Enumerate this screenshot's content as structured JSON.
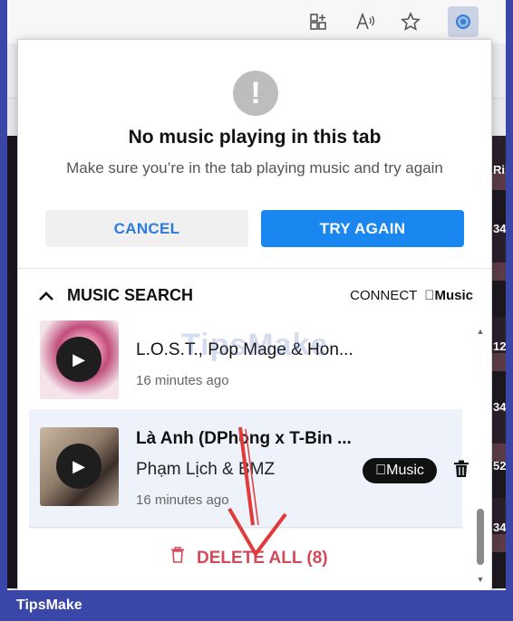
{
  "toolbar": {
    "icons": [
      "add-collection-icon",
      "read-aloud-icon",
      "favorite-star-icon",
      "extension-icon"
    ]
  },
  "background": {
    "side_labels": [
      "Rin",
      "34",
      "12",
      "34",
      "52",
      "34"
    ]
  },
  "popup": {
    "title": "No music playing in this tab",
    "subtitle": "Make sure you’re in the tab playing music and try again",
    "cancel_label": "CANCEL",
    "try_again_label": "TRY AGAIN"
  },
  "music_search": {
    "header": "MUSIC SEARCH",
    "connect_label": "CONNECT",
    "apple_music_label": "Music",
    "items": [
      {
        "title": "L.O.S.T., Pop Mage & Hon...",
        "time": "16 minutes ago"
      },
      {
        "title": "Là Anh (DPhong x T-Bin ...",
        "artist": "Phạm Lịch & BMZ",
        "time": "16 minutes ago",
        "badge": "Music"
      }
    ],
    "delete_all_label": "DELETE ALL (8)"
  },
  "watermark": "TipsMake",
  "footer": {
    "brand": "TipsMake"
  },
  "colors": {
    "accent": "#1a86f0",
    "cancel_text": "#2b7be0",
    "delete": "#d14a5a",
    "footer": "#3a47a8"
  }
}
